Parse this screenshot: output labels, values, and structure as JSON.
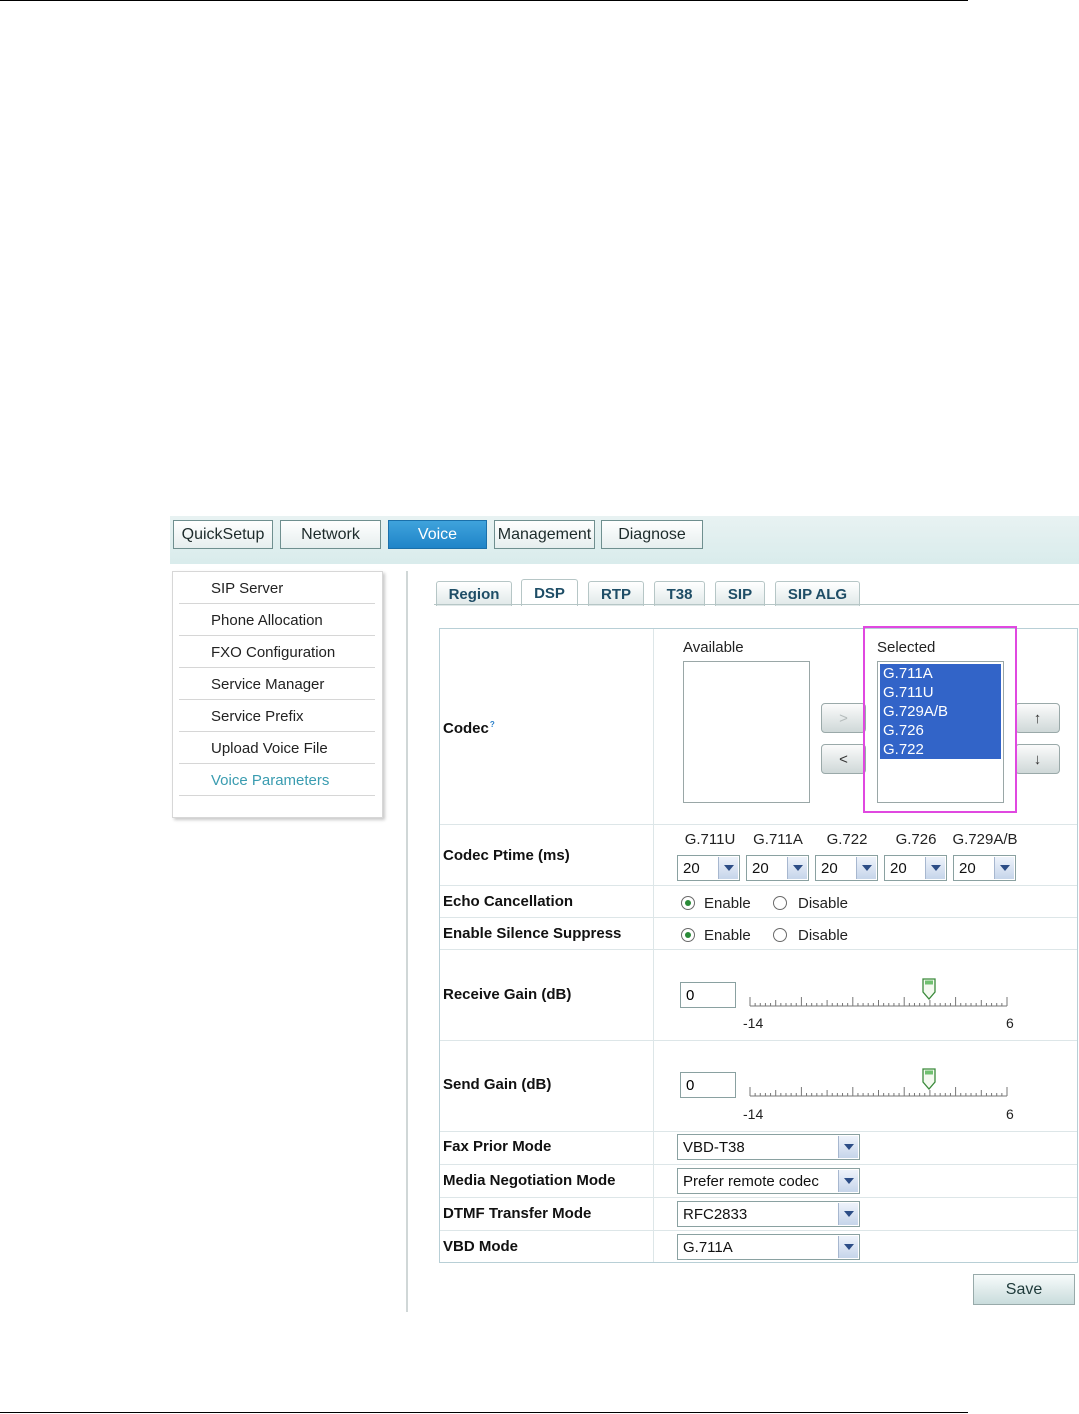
{
  "nav": {
    "items": [
      "QuickSetup",
      "Network",
      "Voice",
      "Management",
      "Diagnose"
    ],
    "active": "Voice"
  },
  "sidebar": {
    "items": [
      "SIP Server",
      "Phone Allocation",
      "FXO Configuration",
      "Service Manager",
      "Service Prefix",
      "Upload Voice File",
      "Voice Parameters"
    ],
    "active": "Voice Parameters"
  },
  "tabs": {
    "items": [
      "Region",
      "DSP",
      "RTP",
      "T38",
      "SIP",
      "SIP ALG"
    ],
    "active": "DSP"
  },
  "codec": {
    "label": "Codec",
    "help_mark": "?",
    "available_title": "Available",
    "selected_title": "Selected",
    "available": [],
    "selected": [
      "G.711A",
      "G.711U",
      "G.729A/B",
      "G.726",
      "G.722"
    ],
    "add_button": ">",
    "remove_button": "<",
    "up_button": "↑",
    "down_button": "↓"
  },
  "ptime": {
    "label": "Codec Ptime  (ms)",
    "codecs": [
      "G.711U",
      "G.711A",
      "G.722",
      "G.726",
      "G.729A/B"
    ],
    "values": [
      "20",
      "20",
      "20",
      "20",
      "20"
    ]
  },
  "echo": {
    "label": "Echo Cancellation",
    "enable": "Enable",
    "disable": "Disable",
    "value": "Enable"
  },
  "silence": {
    "label": "Enable Silence Suppress",
    "enable": "Enable",
    "disable": "Disable",
    "value": "Enable"
  },
  "receive_gain": {
    "label": "Receive Gain  (dB)",
    "value": "0",
    "min": "-14",
    "max": "6"
  },
  "send_gain": {
    "label": "Send Gain  (dB)",
    "value": "0",
    "min": "-14",
    "max": "6"
  },
  "fax_prior": {
    "label": "Fax Prior Mode",
    "value": "VBD-T38"
  },
  "media_negotiation": {
    "label": "Media Negotiation Mode",
    "value": "Prefer remote codec"
  },
  "dtmf": {
    "label": "DTMF Transfer Mode",
    "value": "RFC2833"
  },
  "vbd": {
    "label": "VBD Mode",
    "value": "G.711A"
  },
  "save_label": "Save",
  "colors": {
    "active_nav": "#1f84c8",
    "selection": "#3264c8",
    "highlight": "#e048e0",
    "active_menu": "#3a9cb0"
  }
}
